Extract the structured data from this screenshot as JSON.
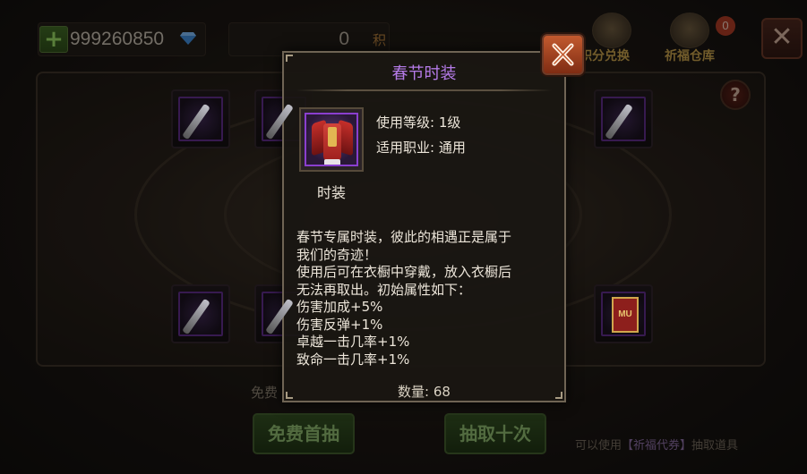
{
  "topbar": {
    "gem_count": "999260850",
    "score_value": "0",
    "score_unit": "积",
    "exchange_label": "积分兑换",
    "warehouse_label": "祈福仓库",
    "warehouse_badge": "0",
    "help_label": "?"
  },
  "background": {
    "slot_banner_text": "MU",
    "free_text": "免费",
    "free_draw_button": "免费首抽",
    "draw_ten_button": "抽取十次",
    "hint_prefix": "可以使用",
    "hint_highlight": "【祈福代券】",
    "hint_suffix": "抽取道具"
  },
  "item_popup": {
    "title": "春节时装",
    "level_requirement": "使用等级: 1级",
    "class_requirement": "适用职业: 通用",
    "item_type": "时装",
    "description_lines": [
      "春节专属时装，彼此的相遇正是属于",
      "我们的奇迹！",
      "使用后可在衣橱中穿戴，放入衣橱后",
      "无法再取出。初始属性如下：",
      "伤害加成+5%",
      "伤害反弹+1%",
      "卓越一击几率+1%",
      "致命一击几率+1%"
    ],
    "quantity": "数量: 68",
    "colors": {
      "title": "#b57be8",
      "rarity_border": "#8a3fcf"
    }
  },
  "icons": {
    "close": "close-icon",
    "gem": "diamond-icon",
    "plus": "plus-icon",
    "costume": "costume-icon"
  }
}
